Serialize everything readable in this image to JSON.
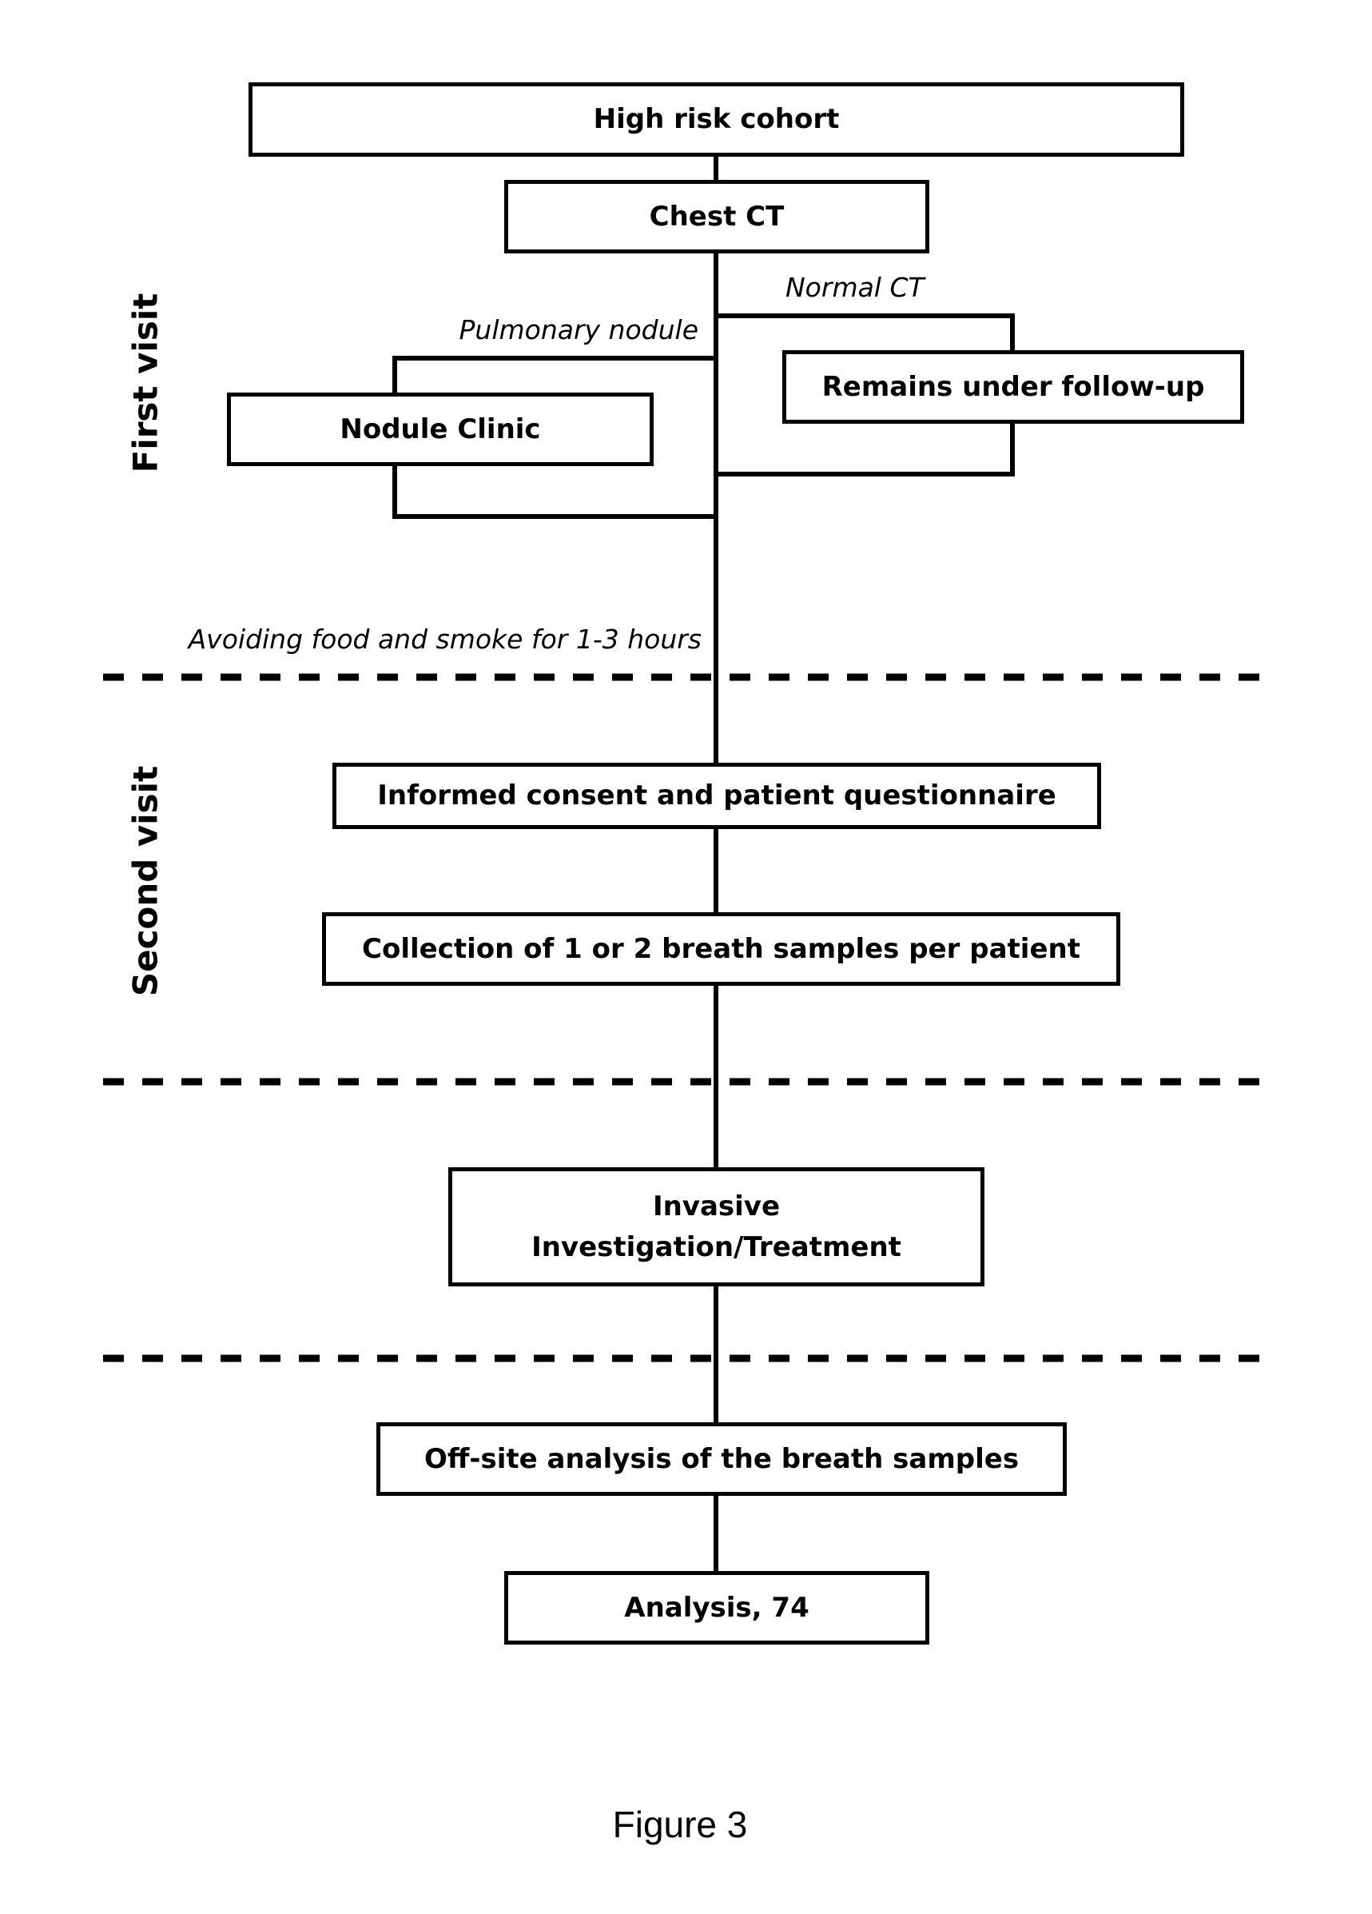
{
  "figure": {
    "caption": "Figure 3",
    "phase_labels": {
      "first_visit": "First visit",
      "second_visit": "Second visit"
    },
    "nodes": {
      "high_risk_cohort": "High risk cohort",
      "chest_ct": "Chest CT",
      "remains_follow_up": "Remains under follow-up",
      "nodule_clinic": "Nodule Clinic",
      "informed_consent": "Informed consent and patient questionnaire",
      "breath_collection": "Collection of 1 or 2 breath samples per patient",
      "invasive_line1": "Invasive",
      "invasive_line2": "Investigation/Treatment",
      "offsite_analysis": "Off-site analysis of the breath samples",
      "analysis": "Analysis, 74"
    },
    "edge_labels": {
      "normal_ct": "Normal CT",
      "pulmonary_nodule": "Pulmonary nodule",
      "avoiding": "Avoiding food and smoke for 1-3 hours"
    },
    "colors": {
      "line": "#000000",
      "background": "#ffffff"
    }
  }
}
